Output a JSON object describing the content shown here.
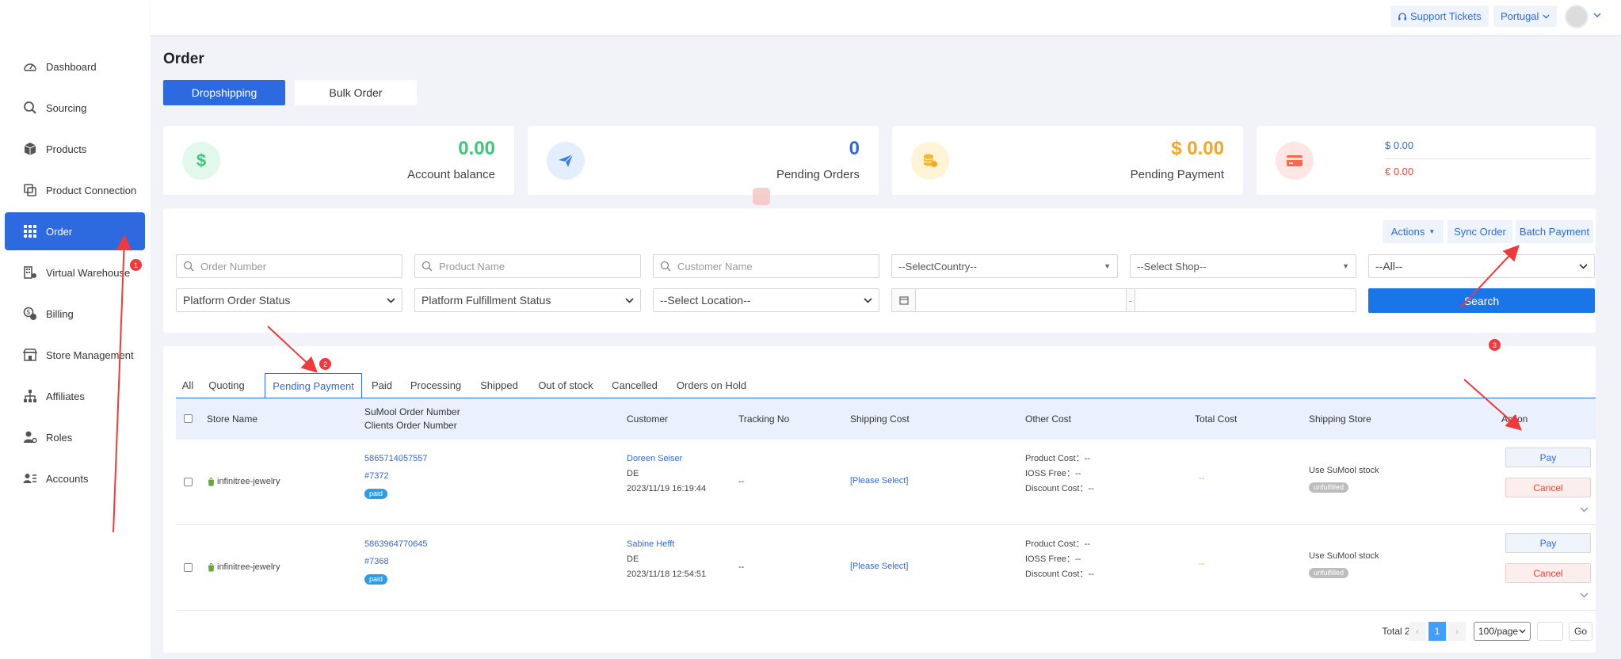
{
  "sidebar": {
    "items": [
      {
        "label": "Dashboard",
        "icon": "dashboard-icon"
      },
      {
        "label": "Sourcing",
        "icon": "search-icon"
      },
      {
        "label": "Products",
        "icon": "box-icon"
      },
      {
        "label": "Product Connection",
        "icon": "link-squares-icon"
      },
      {
        "label": "Order",
        "icon": "grid-icon",
        "active": true
      },
      {
        "label": "Virtual Warehouse",
        "icon": "warehouse-icon"
      },
      {
        "label": "Billing",
        "icon": "billing-icon"
      },
      {
        "label": "Store Management",
        "icon": "store-icon"
      },
      {
        "label": "Affiliates",
        "icon": "network-icon"
      },
      {
        "label": "Roles",
        "icon": "user-gear-icon"
      },
      {
        "label": "Accounts",
        "icon": "accounts-icon"
      }
    ]
  },
  "topbar": {
    "support_label": "Support Tickets",
    "language_label": "Portugal"
  },
  "page": {
    "title": "Order",
    "tabs": [
      "Dropshipping",
      "Bulk Order"
    ]
  },
  "stats": {
    "balance_value": "0.00",
    "balance_label": "Account balance",
    "pending_orders_value": "0",
    "pending_orders_label": "Pending Orders",
    "pending_payment_value": "$ 0.00",
    "pending_payment_label": "Pending Payment",
    "usd_value": "$ 0.00",
    "eur_value": "€ 0.00"
  },
  "filters": {
    "actions_label": "Actions",
    "sync_label": "Sync Order",
    "batch_label": "Batch Payment",
    "order_number_placeholder": "Order Number",
    "product_name_placeholder": "Product Name",
    "customer_name_placeholder": "Customer Name",
    "country_value": "--SelectCountry--",
    "shop_value": "--Select Shop--",
    "all_value": "--All--",
    "platform_order_status": "Platform Order Status",
    "platform_fulfillment_status": "Platform Fulfillment Status",
    "location_value": "--Select Location--",
    "date_separator": "-",
    "search_label": "Search"
  },
  "status_tabs": [
    "All",
    "Quoting",
    "Pending Payment",
    "Paid",
    "Processing",
    "Shipped",
    "Out of stock",
    "Cancelled",
    "Orders on Hold"
  ],
  "table": {
    "headers": {
      "store_name": "Store Name",
      "order_number_1": "SuMool Order Number",
      "order_number_2": "Clients Order Number",
      "customer": "Customer",
      "tracking": "Tracking No",
      "shipping_cost": "Shipping Cost",
      "other_cost": "Other Cost",
      "total_cost": "Total Cost",
      "shipping_store": "Shipping Store",
      "action": "Action"
    },
    "rows": [
      {
        "store": "infinitree-jewelry",
        "sumool_order": "5865714057557",
        "client_order": "#7372",
        "paid_badge": "paid",
        "customer": "Doreen Seiser",
        "country": "DE",
        "date": "2023/11/19 16:19:44",
        "tracking": "--",
        "shipping_cost": "[Please Select]",
        "product_cost": "Product Cost：--",
        "ioss_fee": "IOSS Free：--",
        "discount_cost": "Discount Cost：--",
        "total_cost": "--",
        "shipping_store": "Use SuMool stock",
        "fulfill_badge": "unfulfilled",
        "pay_label": "Pay",
        "cancel_label": "Cancel"
      },
      {
        "store": "infinitree-jewelry",
        "sumool_order": "5863964770645",
        "client_order": "#7368",
        "paid_badge": "paid",
        "customer": "Sabine Hefft",
        "country": "DE",
        "date": "2023/11/18 12:54:51",
        "tracking": "--",
        "shipping_cost": "[Please Select]",
        "product_cost": "Product Cost：--",
        "ioss_fee": "IOSS Free：--",
        "discount_cost": "Discount Cost：--",
        "total_cost": "--",
        "shipping_store": "Use SuMool stock",
        "fulfill_badge": "unfulfilled",
        "pay_label": "Pay",
        "cancel_label": "Cancel"
      }
    ]
  },
  "pagination": {
    "total_label": "Total 2",
    "prev": "‹",
    "current_page": "1",
    "next": "›",
    "page_size": "100/page",
    "go_label": "Go"
  },
  "annotations": [
    "1",
    "2",
    "3"
  ],
  "colors": {
    "primary": "#2d6ae0",
    "green": "#3cc878",
    "orange": "#f5a623",
    "red": "#f44336"
  }
}
